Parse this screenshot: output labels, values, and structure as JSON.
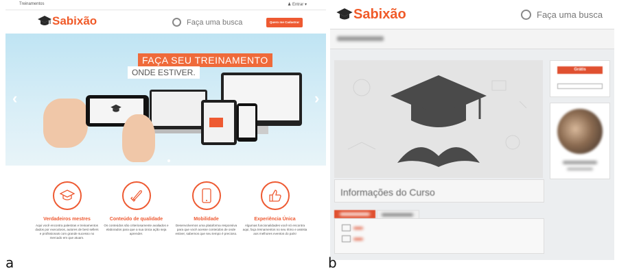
{
  "figure_labels": {
    "a": "a",
    "b": "b"
  },
  "panel_a": {
    "topbar": {
      "left": "Treinamentos",
      "right": "Entrar"
    },
    "logo": "Sabixão",
    "search_placeholder": "Faça uma busca",
    "cta": "Quero me Cadastrar",
    "hero": {
      "headline": "FAÇA SEU TREINAMENTO",
      "subheadline": "ONDE ESTIVER."
    },
    "features": [
      {
        "title": "Verdadeiros mestres",
        "desc": "Aqui você encontra palestras e treinamentos dados por executivos, autores de best sellers e profissionais com grande sucesso no mercado em que atuam.",
        "icon": "graduation-cap-icon"
      },
      {
        "title": "Conteúdo de qualidade",
        "desc": "Os conteúdos são criteriosamente avaliados e elaborados para que a sua única ação seja aprender.",
        "icon": "rocket-icon"
      },
      {
        "title": "Mobilidade",
        "desc": "Desenvolvemos uma plataforma responsiva para que você acesse conteúdos de onde estiver, sabemos que seu tempo é precioso.",
        "icon": "tablet-icon"
      },
      {
        "title": "Experiência Única",
        "desc": "Algumas funcionalidades você só encontra aqui, faça treinamentos no seu ritmo e assista aos melhores eventos do país!",
        "icon": "thumbs-up-icon"
      }
    ],
    "colors": {
      "accent": "#ee5a32"
    }
  },
  "panel_b": {
    "logo": "Sabixão",
    "search_placeholder": "Faça uma busca",
    "info_title": "Informações do Curso",
    "gratis_button": "Grátis"
  }
}
